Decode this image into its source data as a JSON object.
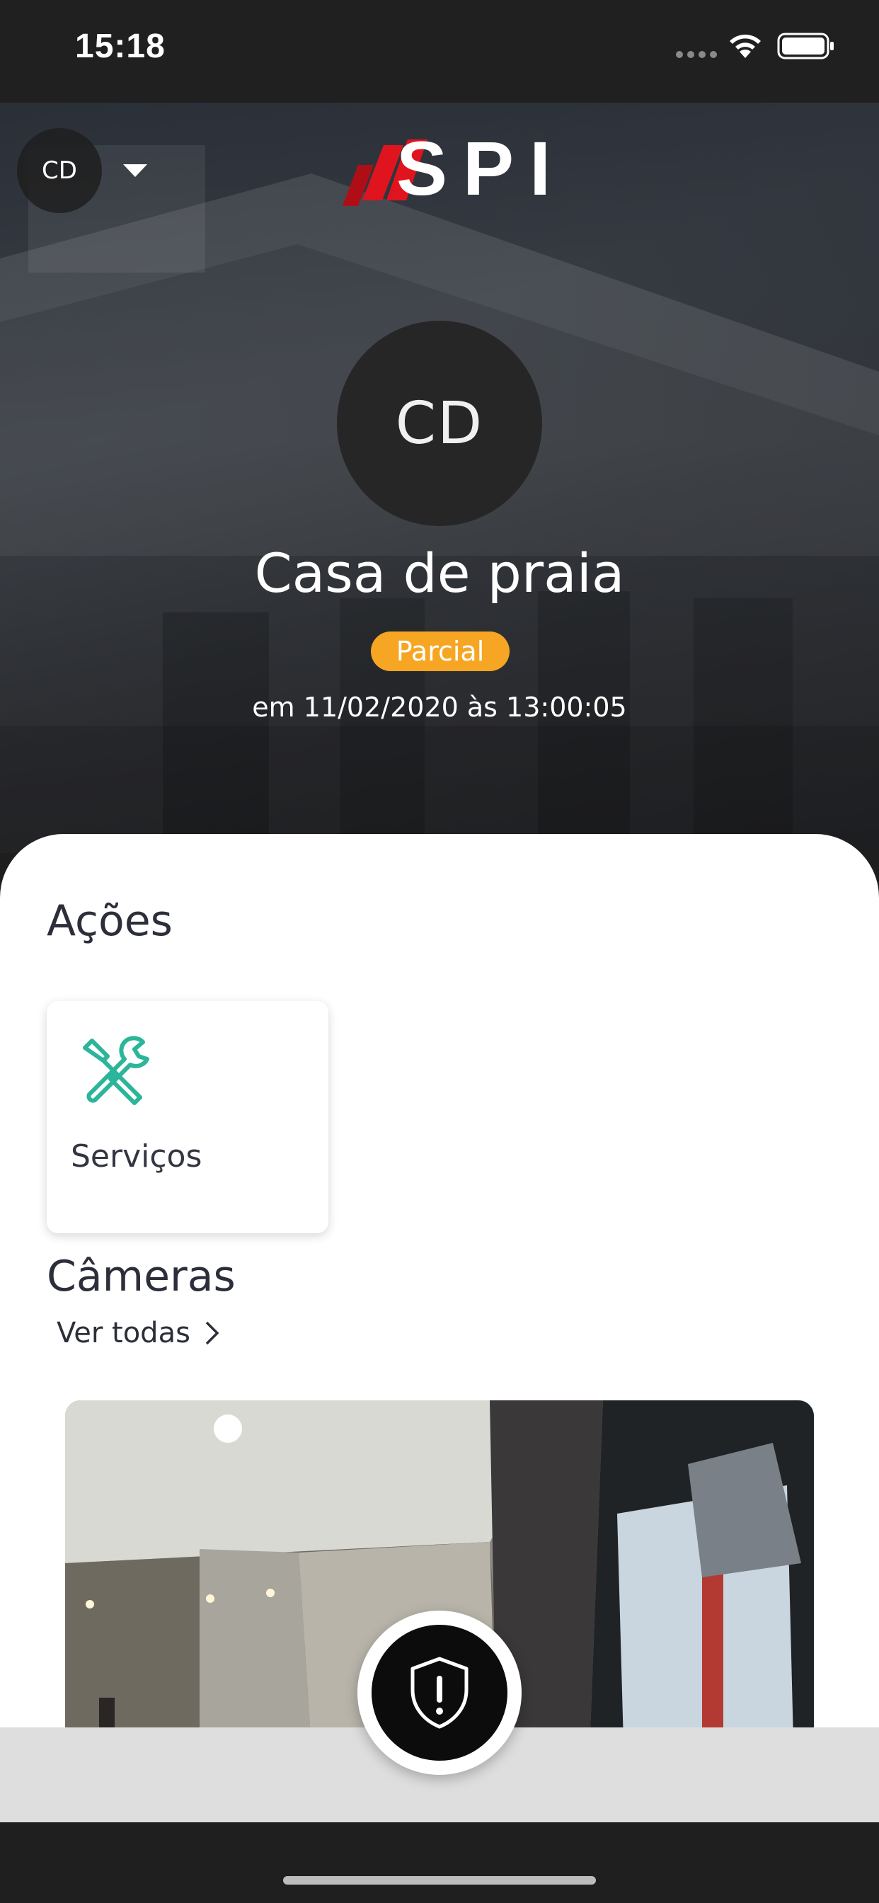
{
  "status_bar": {
    "time": "15:18",
    "icons": [
      "signal-dots-icon",
      "wifi-icon",
      "battery-icon"
    ]
  },
  "header": {
    "account_initials": "CD",
    "logo_text": "SPI",
    "logo_color": "#e0141e"
  },
  "profile": {
    "initials": "CD",
    "place_name": "Casa de praia",
    "status_label": "Parcial",
    "status_color": "#f6a623",
    "status_time": "em 11/02/2020 às 13:00:05"
  },
  "actions": {
    "title": "Ações",
    "items": [
      {
        "label": "Serviços",
        "icon": "tools-icon",
        "icon_color": "#2bb59a"
      }
    ]
  },
  "cameras": {
    "title": "Câmeras",
    "see_all_label": "Ver todas"
  },
  "panic": {
    "icon": "shield-alert-icon"
  }
}
